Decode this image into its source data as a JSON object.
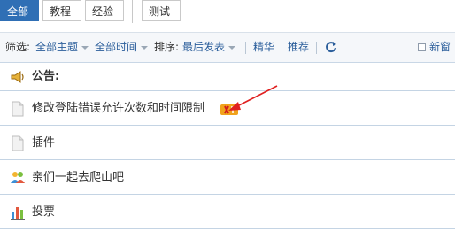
{
  "tabs": [
    {
      "label": "全部",
      "active": true
    },
    {
      "label": "教程",
      "active": false
    },
    {
      "label": "经验",
      "active": false
    },
    {
      "label": "测试",
      "active": false
    }
  ],
  "filter": {
    "label": "筛选:",
    "topic": "全部主题",
    "time": "全部时间",
    "sort_label": "排序:",
    "sort_value": "最后发表",
    "digest": "精华",
    "recommend": "推荐",
    "new_label": "新窗"
  },
  "threads": [
    {
      "kind": "notice",
      "text": "公告:",
      "icon": "megaphone-icon"
    },
    {
      "kind": "thread",
      "text": "修改登陆错误允许次数和时间限制",
      "icon": "document-icon",
      "badge": "hot-badge"
    },
    {
      "kind": "thread",
      "text": "插件",
      "icon": "document-icon"
    },
    {
      "kind": "thread",
      "text": "亲们一起去爬山吧",
      "icon": "group-icon"
    },
    {
      "kind": "thread",
      "text": "投票",
      "icon": "poll-icon"
    }
  ],
  "colors": {
    "accent": "#2f6fb5",
    "link": "#2b5e9b",
    "filter_bg": "#f5f7fa",
    "divider": "#c4d4e4",
    "annotation_arrow": "#e02020"
  }
}
